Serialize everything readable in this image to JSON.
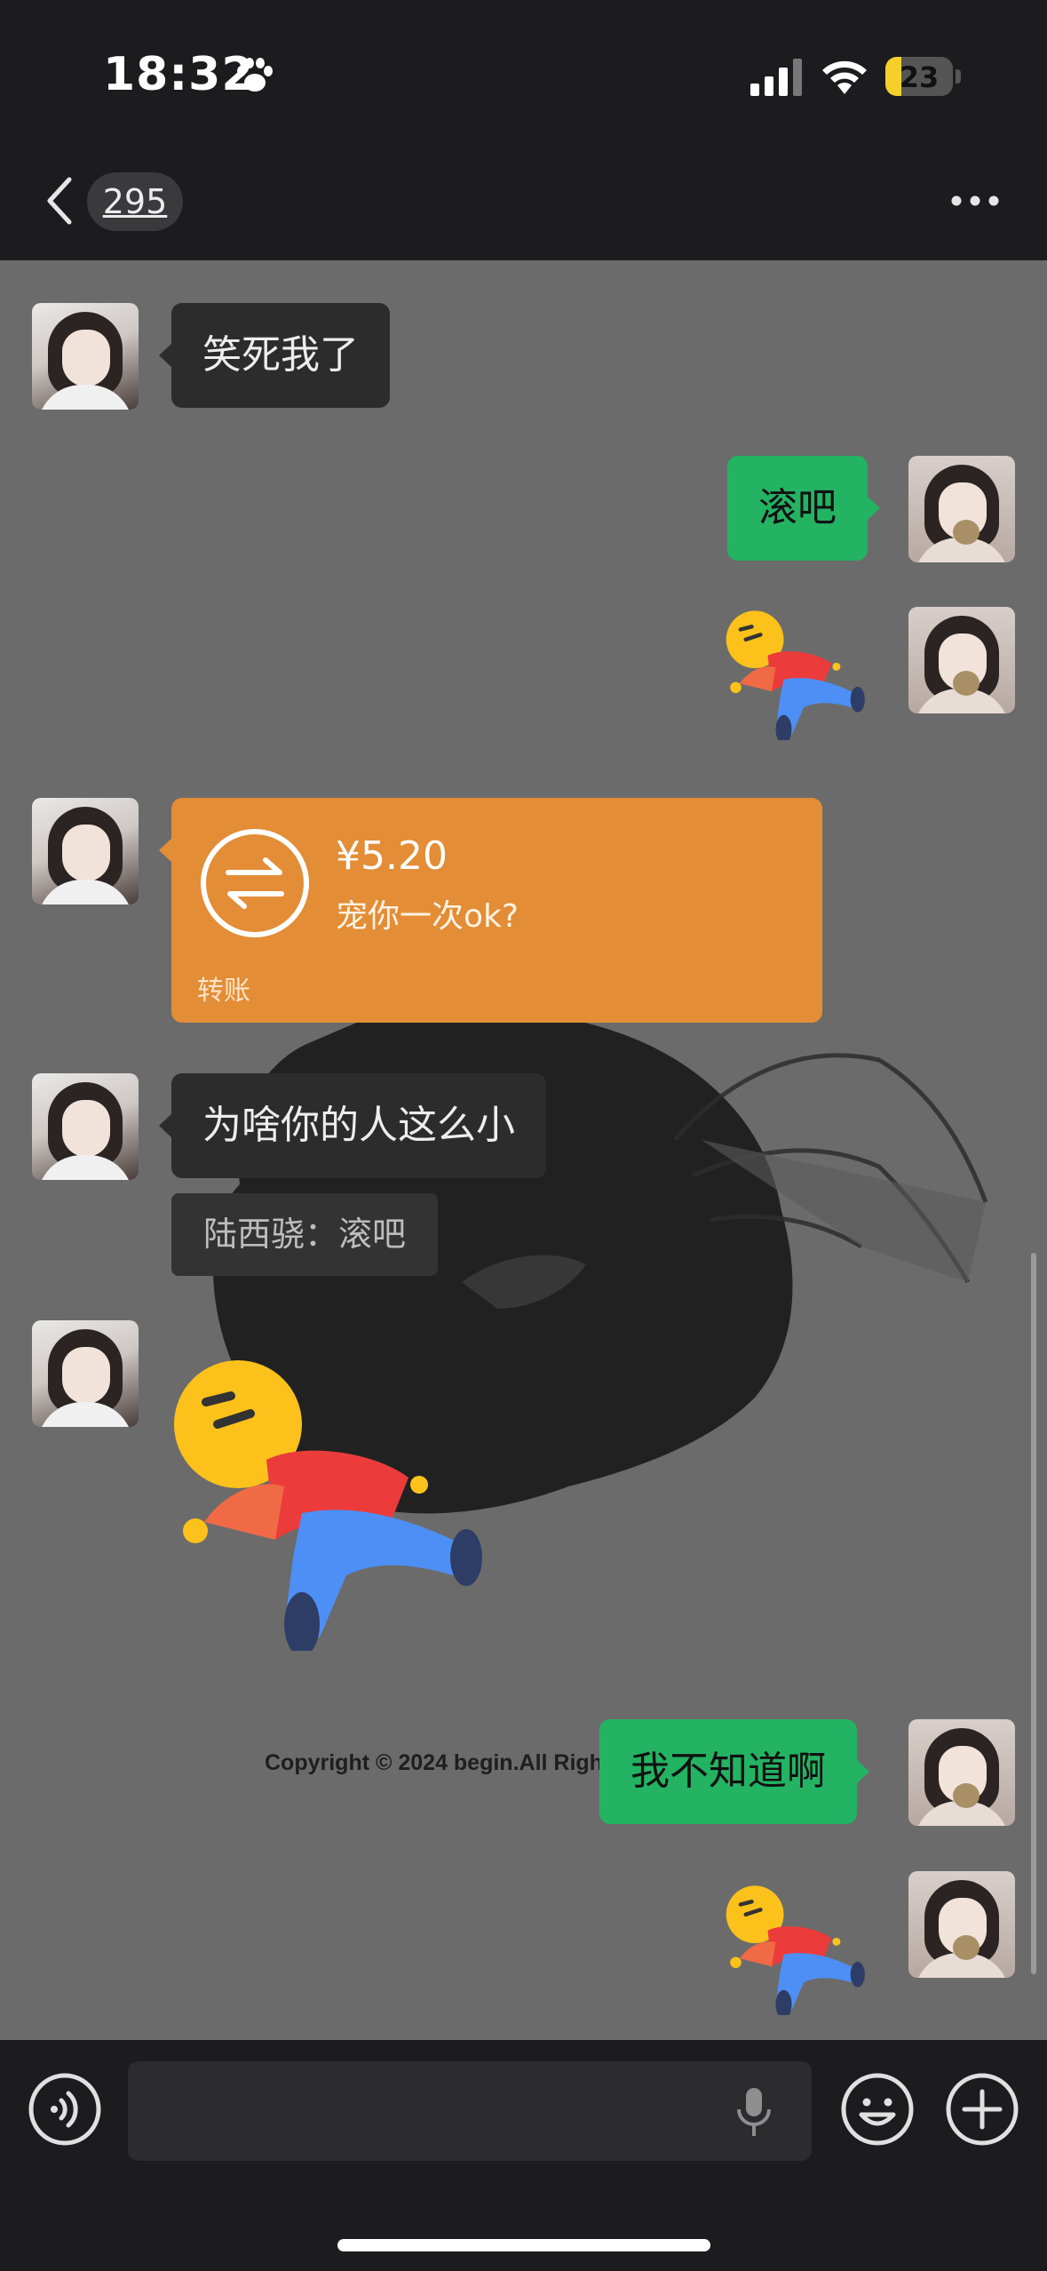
{
  "status_bar": {
    "time": "18:32",
    "battery": "23"
  },
  "nav": {
    "unread_count": "295"
  },
  "messages": [
    {
      "side": "in",
      "type": "text",
      "text": "笑死我了"
    },
    {
      "side": "out",
      "type": "text",
      "text": "滚吧"
    },
    {
      "side": "out",
      "type": "sticker",
      "sticker": "lying-down-emoji"
    },
    {
      "side": "in",
      "type": "transfer",
      "amount": "¥5.20",
      "note": "宠你一次ok?",
      "label": "转账"
    },
    {
      "side": "in",
      "type": "text",
      "text": "为啥你的人这么小",
      "quote": "陆西骁：滚吧"
    },
    {
      "side": "in",
      "type": "sticker",
      "sticker": "lying-down-emoji"
    },
    {
      "side": "out",
      "type": "text",
      "text": "我不知道啊"
    },
    {
      "side": "out",
      "type": "sticker",
      "sticker": "lying-down-emoji"
    }
  ],
  "background": {
    "copyright": "Copyright © 2024 begin.All Righ"
  },
  "input_bar": {
    "placeholder": ""
  },
  "colors": {
    "outgoing_bubble": "#23b363",
    "incoming_bubble": "#2c2c2c",
    "transfer_card": "#e38d36",
    "chat_background": "#6b6b6b",
    "bars": "#1c1c1e"
  }
}
